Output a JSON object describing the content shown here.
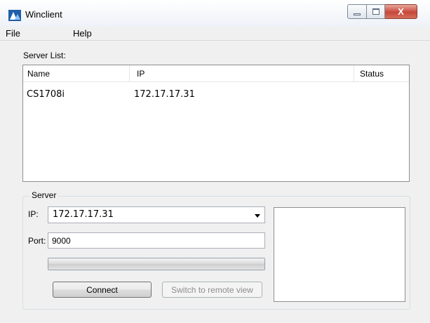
{
  "window": {
    "title": "Winclient",
    "close_glyph": "X",
    "icons": [
      "app-logo-icon",
      "minimize-icon",
      "maximize-icon",
      "close-icon"
    ]
  },
  "menu": {
    "file": "File",
    "help": "Help"
  },
  "server_list": {
    "label": "Server List:",
    "columns": [
      "Name",
      "IP",
      "Status"
    ],
    "rows": [
      {
        "name": "CS1708i",
        "ip": "172.17.17.31",
        "status": ""
      }
    ]
  },
  "server": {
    "group_label": "Server",
    "ip_label": "IP:",
    "ip_value": "172.17.17.31",
    "port_label": "Port:",
    "port_value": "9000",
    "progress": 0,
    "connect_label": "Connect",
    "switch_label": "Switch to remote view"
  },
  "colors": {
    "close_button": "#c7463a",
    "window_bg": "#f0f0f0",
    "disabled_text": "#8d8d8d"
  }
}
